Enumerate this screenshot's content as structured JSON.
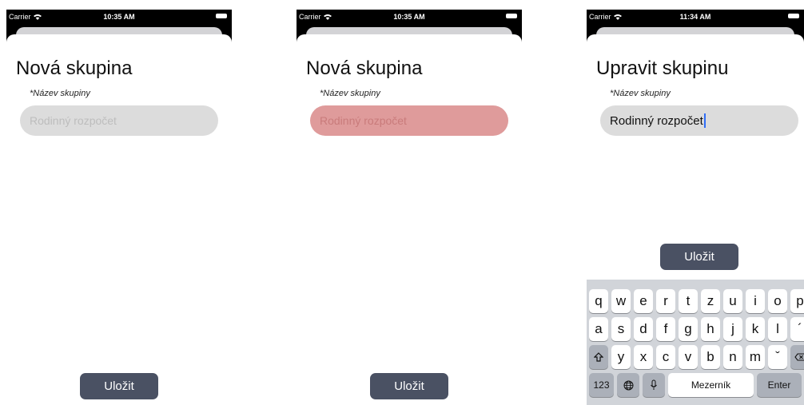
{
  "screens": [
    {
      "status_bar": {
        "carrier": "Carrier",
        "time": "10:35 AM"
      },
      "title": "Nová skupina",
      "field_label": "*Název skupiny",
      "input_placeholder": "Rodinný rozpočet",
      "save_label": "Uložit"
    },
    {
      "status_bar": {
        "carrier": "Carrier",
        "time": "10:35 AM"
      },
      "title": "Nová skupina",
      "field_label": "*Název skupiny",
      "input_placeholder": "Rodinný rozpočet",
      "input_state": "error",
      "save_label": "Uložit"
    },
    {
      "status_bar": {
        "carrier": "Carrier",
        "time": "11:34 AM"
      },
      "title": "Upravit skupinu",
      "field_label": "*Název skupiny",
      "input_value": "Rodinný rozpočet",
      "save_label": "Uložit",
      "keyboard": {
        "row1": [
          "q",
          "w",
          "e",
          "r",
          "t",
          "z",
          "u",
          "i",
          "o",
          "p"
        ],
        "row2": [
          "a",
          "s",
          "d",
          "f",
          "g",
          "h",
          "j",
          "k",
          "l",
          "´"
        ],
        "row3": [
          "y",
          "x",
          "c",
          "v",
          "b",
          "n",
          "m",
          "ˇ"
        ],
        "numbers_label": "123",
        "space_label": "Mezerník",
        "enter_label": "Enter"
      }
    }
  ],
  "colors": {
    "button": "#4a5163",
    "input_bg": "#dcdcdc",
    "input_error_bg": "#df9b9b",
    "keyboard_bg": "#d1d4d9",
    "caret": "#2f6df6"
  },
  "icons": [
    "wifi-icon",
    "battery-icon",
    "shift-icon",
    "globe-icon",
    "microphone-icon",
    "backspace-icon"
  ]
}
